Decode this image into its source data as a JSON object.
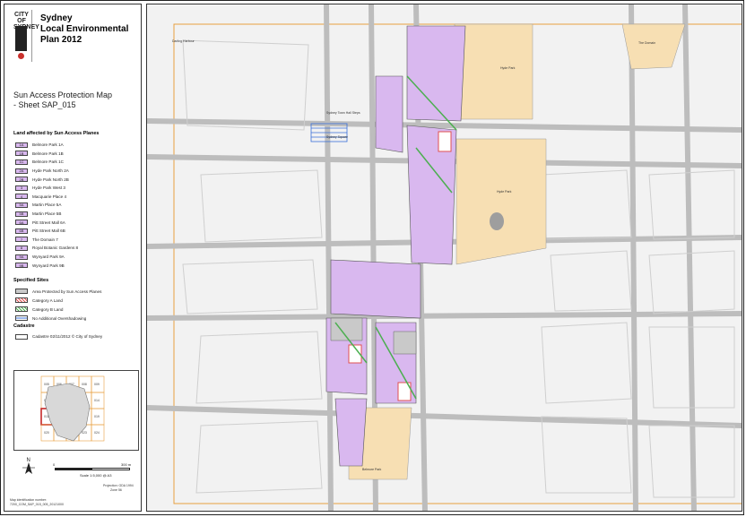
{
  "header": {
    "logo_text": "CITY OF SYDNEY",
    "title_lines": [
      "Sydney",
      "Local Environmental",
      "Plan 2012"
    ],
    "subtitle_lines": [
      "Sun Access Protection Map",
      "- Sheet SAP_015"
    ]
  },
  "legend": {
    "section_title": "Land affected by Sun Access Planes",
    "items": [
      {
        "code": "1A",
        "label": "Belmore Park 1A"
      },
      {
        "code": "1B",
        "label": "Belmore Park 1B"
      },
      {
        "code": "1C",
        "label": "Belmore Park 1C"
      },
      {
        "code": "2A",
        "label": "Hyde Park North 2A"
      },
      {
        "code": "2B",
        "label": "Hyde Park North 2B"
      },
      {
        "code": "3",
        "label": "Hyde Park West 3"
      },
      {
        "code": "4",
        "label": "Macquarie Place 4"
      },
      {
        "code": "5A",
        "label": "Martin Place 5A"
      },
      {
        "code": "5B",
        "label": "Martin Place 5B"
      },
      {
        "code": "6A",
        "label": "Pitt Street Mall 6A"
      },
      {
        "code": "6B",
        "label": "Pitt Street Mall 6B"
      },
      {
        "code": "7",
        "label": "The Domain 7"
      },
      {
        "code": "8",
        "label": "Royal Botanic Gardens 8"
      },
      {
        "code": "9A",
        "label": "Wynyard Park 9A"
      },
      {
        "code": "9B",
        "label": "Wynyard Park 9B"
      }
    ],
    "sites_title": "Specified Sites",
    "sites": [
      {
        "label": "Area Protected by Sun Access Planes",
        "style": "grey"
      },
      {
        "label": "Category A Land",
        "style": "red"
      },
      {
        "label": "Category B Land",
        "style": "green"
      },
      {
        "label": "No Additional Overshadowing",
        "style": "blue"
      }
    ],
    "cadastre_title": "Cadastre",
    "cadastre_item": "Cadastre 02/11/2012 © City of Sydney"
  },
  "inset": {
    "highlight_sheet": "015",
    "sheet_numbers": [
      "005",
      "006",
      "007",
      "008",
      "009",
      "010",
      "011",
      "012",
      "013",
      "014",
      "015",
      "016",
      "017",
      "018",
      "019",
      "020",
      "021",
      "022",
      "023",
      "024"
    ]
  },
  "footer": {
    "scale_start": "0",
    "scale_end": "300 m",
    "scale_text": "Scale 1:5,000 @ A3",
    "projection_lines": [
      "Projection: GDA 1994",
      "Zone 56"
    ],
    "map_id_lines": [
      "Map identification number:",
      "7200_COM_SAP_015_005_20121000"
    ]
  },
  "map": {
    "labels": [
      "Darling Harbour",
      "The Domain",
      "Hyde Park",
      "Sydney Town Hall Steps",
      "Sydney Square",
      "Hyde Park",
      "Belmore Park"
    ]
  },
  "colors": {
    "sun_access": "#d9b8ef",
    "park": "#f7dfb3",
    "category_a": "#e05050",
    "category_b": "#4caf50",
    "no_overshadow": "#3a6fd8",
    "sheet_outline": "#e8a040"
  }
}
